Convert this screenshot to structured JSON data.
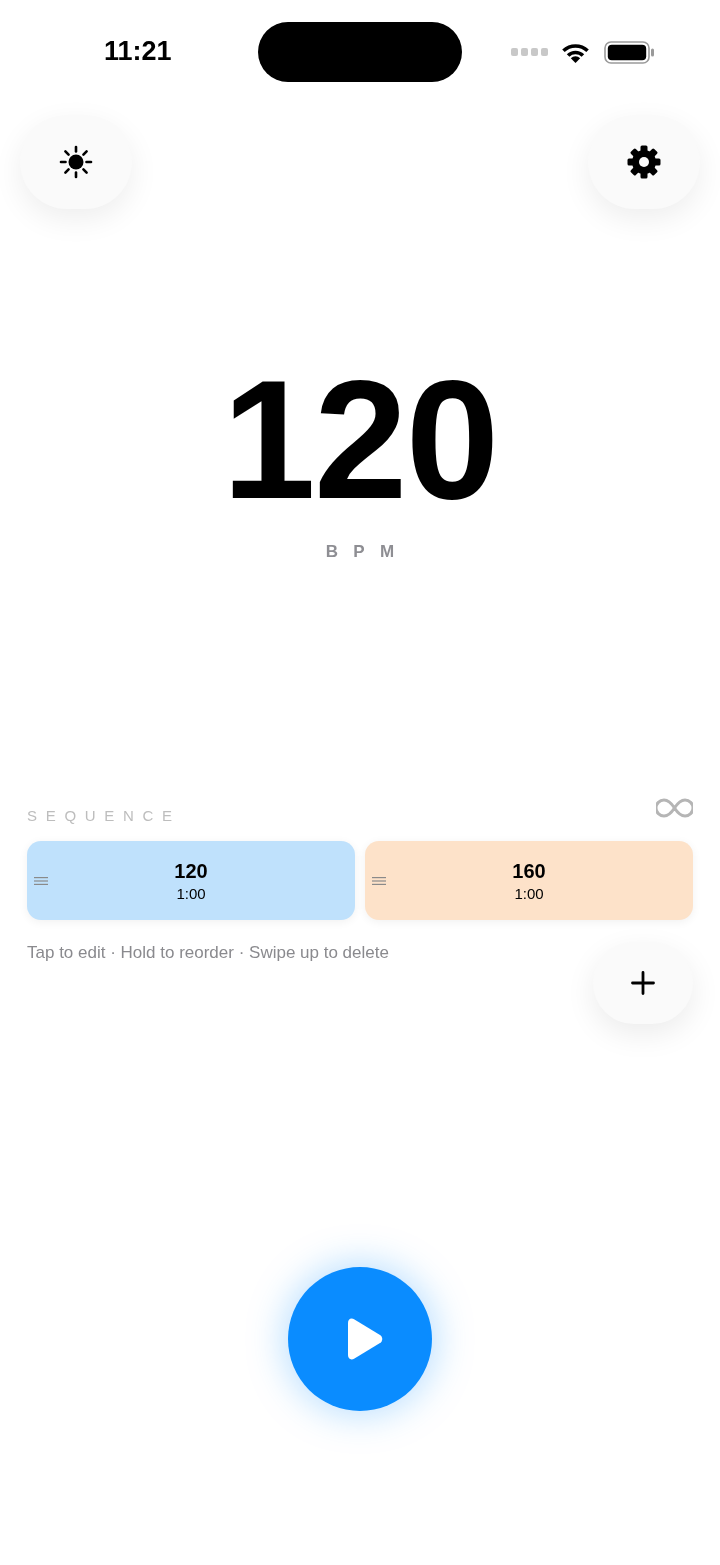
{
  "status_bar": {
    "time": "11:21"
  },
  "tempo": {
    "value": "120",
    "unit": "BPM"
  },
  "sequence": {
    "title": "SEQUENCE",
    "loop_on": false,
    "segments": [
      {
        "bpm": "120",
        "duration": "1:00",
        "color": "#bfe1fc"
      },
      {
        "bpm": "160",
        "duration": "1:00",
        "color": "#fde2c9"
      }
    ],
    "hint": "Tap to edit · Hold to reorder · Swipe up to delete"
  },
  "transport": {
    "playing": false
  }
}
